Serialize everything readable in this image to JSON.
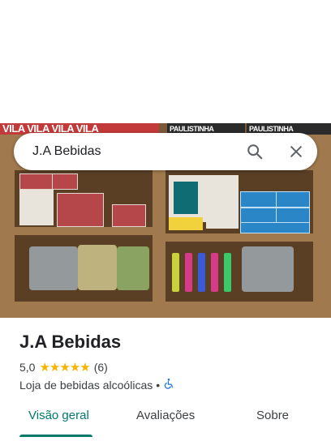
{
  "search": {
    "query": "J.A Bebidas"
  },
  "photo": {
    "banner_text_1": "VILA VILA VILA VILA",
    "banner_text_2": "PAULISTINHA",
    "banner_text_3": "PAULISTINHA"
  },
  "place": {
    "name": "J.A Bebidas",
    "rating": "5,0",
    "stars": "★★★★★",
    "review_count": "(6)",
    "category": "Loja de bebidas alcoólicas",
    "separator": "•"
  },
  "tabs": [
    {
      "label": "Visão geral",
      "active": true
    },
    {
      "label": "Avaliações",
      "active": false
    },
    {
      "label": "Sobre",
      "active": false
    }
  ],
  "colors": {
    "accent": "#00796b",
    "star": "#f4b400",
    "accessibility": "#1a73e8"
  }
}
